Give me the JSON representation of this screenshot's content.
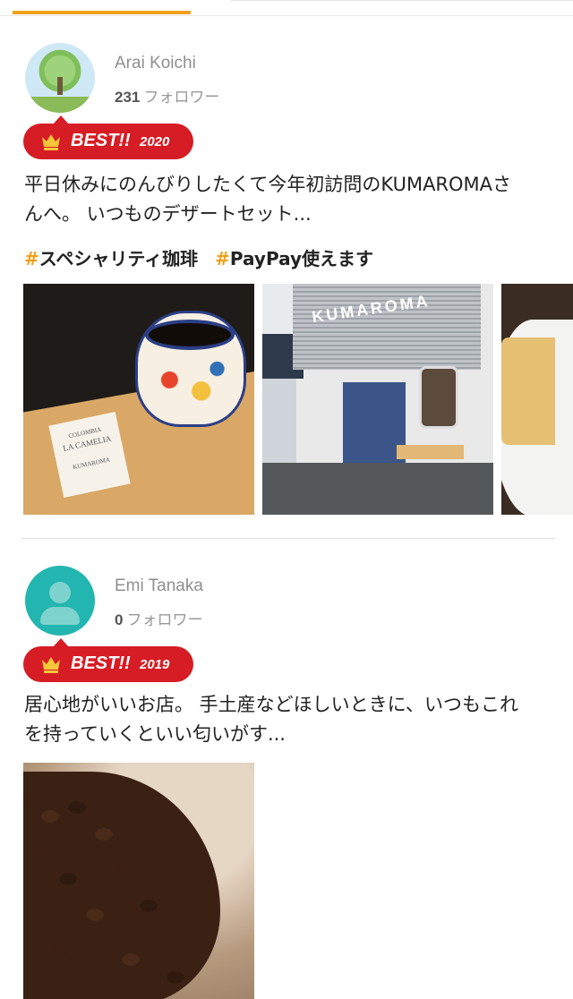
{
  "reviews": [
    {
      "user_name": "Arai Koichi",
      "follower_count": "231",
      "follower_label": "フォロワー",
      "avatar_icon": "tree-photo-avatar",
      "badge": {
        "best_label": "BEST!!",
        "year": "2020",
        "icon": "crown-icon"
      },
      "text_line1": "平日休みにのんびりしたくて今年初訪問のKUMAROMAさ",
      "text_line2": "んへ。 いつものデザートセット...",
      "tags": [
        {
          "hash": "#",
          "label": "スペシャリティ珈琲"
        },
        {
          "hash": "#",
          "label": "PayPay使えます"
        }
      ],
      "photos": {
        "card_line1": "COLOMBIA",
        "card_line2": "LA CAMELIA",
        "card_line3": "KUMAROMA",
        "shop_sign": "KUMAROMA"
      }
    },
    {
      "user_name": "Emi Tanaka",
      "follower_count": "0",
      "follower_label": "フォロワー",
      "avatar_icon": "default-user-icon",
      "badge": {
        "best_label": "BEST!!",
        "year": "2019",
        "icon": "crown-icon"
      },
      "text_line1": "居心地がいいお店。 手土産などほしいときに、いつもこれ",
      "text_line2": "を持っていくといい匂いがす..."
    }
  ],
  "colors": {
    "accent": "#f0a11c",
    "badge_red": "#d61c24",
    "avatar_teal": "#23b5b0"
  }
}
